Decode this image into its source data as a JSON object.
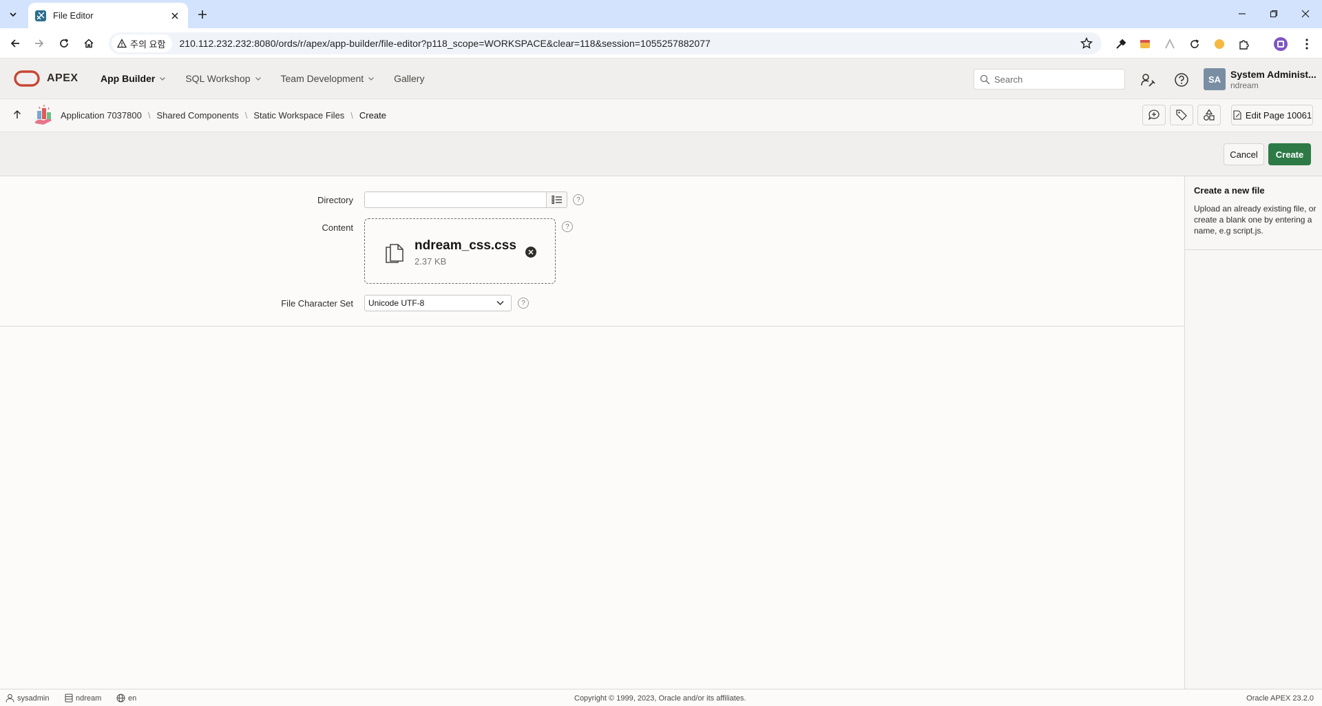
{
  "browser": {
    "tab_title": "File Editor",
    "security_label": "주의 요함",
    "url": "210.112.232.232:8080/ords/r/apex/app-builder/file-editor?p118_scope=WORKSPACE&clear=118&session=1055257882077"
  },
  "header": {
    "brand": "APEX",
    "nav": [
      {
        "label": "App Builder",
        "has_menu": true
      },
      {
        "label": "SQL Workshop",
        "has_menu": true
      },
      {
        "label": "Team Development",
        "has_menu": true
      },
      {
        "label": "Gallery",
        "has_menu": false
      }
    ],
    "search_placeholder": "Search",
    "avatar_initials": "SA",
    "user_name": "System Administ...",
    "user_workspace": "ndream"
  },
  "breadcrumb": {
    "items": [
      "Application 7037800",
      "Shared Components",
      "Static Workspace Files",
      "Create"
    ],
    "edit_page_label": "Edit Page 10061"
  },
  "actions": {
    "cancel_label": "Cancel",
    "create_label": "Create"
  },
  "form": {
    "directory_label": "Directory",
    "directory_value": "",
    "content_label": "Content",
    "file_name": "ndream_css.css",
    "file_size": "2.37 KB",
    "charset_label": "File Character Set",
    "charset_value": "Unicode UTF-8",
    "help_glyph": "?"
  },
  "help_panel": {
    "title": "Create a new file",
    "text": "Upload an already existing file, or create a blank one by entering a name, e.g script.js."
  },
  "footer": {
    "user": "sysadmin",
    "workspace": "ndream",
    "language": "en",
    "copyright": "Copyright © 1999, 2023, Oracle and/or its affiliates.",
    "version": "Oracle APEX 23.2.0"
  },
  "colors": {
    "accent_create": "#2d7a46",
    "oracle_red": "#c74634",
    "avatar": "#7a8ea3"
  }
}
